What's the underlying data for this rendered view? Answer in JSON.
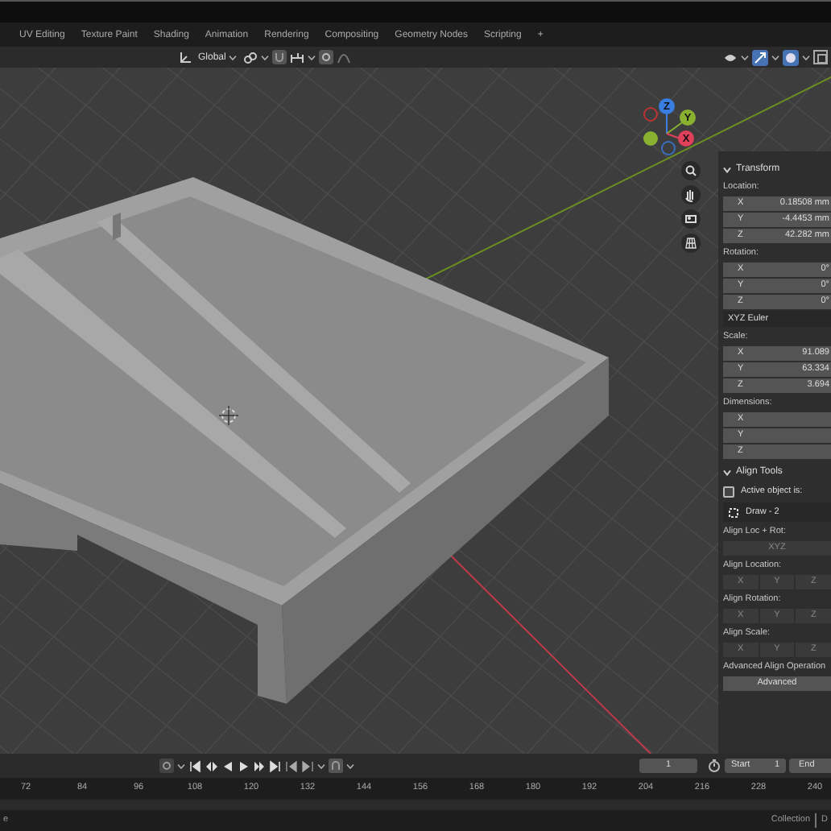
{
  "workspace_tabs": [
    {
      "label": "UV Editing",
      "selected": false
    },
    {
      "label": "Texture Paint",
      "selected": false
    },
    {
      "label": "Shading",
      "selected": false
    },
    {
      "label": "Animation",
      "selected": false
    },
    {
      "label": "Rendering",
      "selected": false
    },
    {
      "label": "Compositing",
      "selected": false
    },
    {
      "label": "Geometry Nodes",
      "selected": false
    },
    {
      "label": "Scripting",
      "selected": false
    }
  ],
  "add_tab": "+",
  "header": {
    "orientation": "Global"
  },
  "gizmo": {
    "x": "X",
    "y": "Y",
    "z": "Z"
  },
  "sidebar": [
    {
      "kind": "panel",
      "label": "Transform",
      "expanded": true
    },
    {
      "kind": "label",
      "label": "Location:"
    },
    {
      "kind": "vector",
      "fields": [
        {
          "axis": "X",
          "value": "0.18508 mm"
        },
        {
          "axis": "Y",
          "value": "-4.4453 mm"
        },
        {
          "axis": "Z",
          "value": "42.282 mm"
        }
      ]
    },
    {
      "kind": "label",
      "label": "Rotation:"
    },
    {
      "kind": "vector",
      "fields": [
        {
          "axis": "X",
          "value": "0°"
        },
        {
          "axis": "Y",
          "value": "0°"
        },
        {
          "axis": "Z",
          "value": "0°"
        }
      ]
    },
    {
      "kind": "dropdown",
      "label": "XYZ Euler"
    },
    {
      "kind": "label",
      "label": "Scale:"
    },
    {
      "kind": "vector",
      "fields": [
        {
          "axis": "X",
          "value": "91.089"
        },
        {
          "axis": "Y",
          "value": "63.334"
        },
        {
          "axis": "Z",
          "value": "3.694"
        }
      ]
    },
    {
      "kind": "label",
      "label": "Dimensions:"
    },
    {
      "kind": "vector",
      "fields": [
        {
          "axis": "X"
        },
        {
          "axis": "Y"
        },
        {
          "axis": "Z"
        }
      ]
    },
    {
      "kind": "panel",
      "label": "Align Tools",
      "expanded": true
    },
    {
      "kind": "checkbox",
      "label": "Active object is:",
      "checked": false
    },
    {
      "kind": "object",
      "label": "Draw - 2"
    },
    {
      "kind": "label",
      "label": "Align Loc + Rot:"
    },
    {
      "kind": "buttons",
      "buttons": [
        "XYZ"
      ]
    },
    {
      "kind": "label",
      "label": "Align Location:"
    },
    {
      "kind": "buttons",
      "buttons": [
        "X",
        "Y",
        "Z"
      ]
    },
    {
      "kind": "label",
      "label": "Align Rotation:"
    },
    {
      "kind": "buttons",
      "buttons": [
        "X",
        "Y",
        "Z"
      ]
    },
    {
      "kind": "label",
      "label": "Align Scale:"
    },
    {
      "kind": "buttons",
      "buttons": [
        "X",
        "Y",
        "Z"
      ]
    },
    {
      "kind": "label",
      "label": "Advanced Align Operation"
    },
    {
      "kind": "button",
      "label": "Advanced"
    }
  ],
  "timeline": {
    "frame": "1",
    "start_label": "Start",
    "start": "1",
    "end_label": "End",
    "ruler": [
      "72",
      "84",
      "96",
      "108",
      "120",
      "132",
      "144",
      "156",
      "168",
      "180",
      "192",
      "204",
      "216",
      "228",
      "240"
    ]
  },
  "status_bar": {
    "left": "e",
    "collection": "Collection",
    "right": "D"
  }
}
